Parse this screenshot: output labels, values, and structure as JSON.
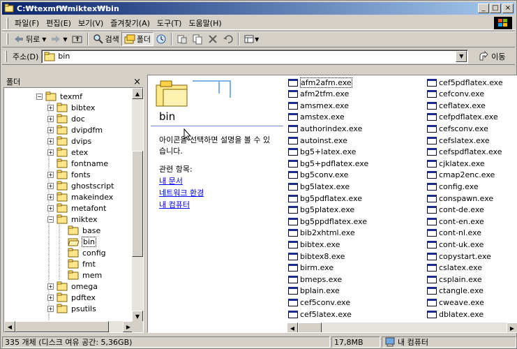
{
  "window": {
    "title": "C:₩texmf₩miktex₩bin",
    "minimize": "_",
    "maximize": "□",
    "close": "×"
  },
  "menu": [
    {
      "label": "파일(F)",
      "name": "menu-file"
    },
    {
      "label": "편집(E)",
      "name": "menu-edit"
    },
    {
      "label": "보기(V)",
      "name": "menu-view"
    },
    {
      "label": "즐겨찾기(A)",
      "name": "menu-favorites"
    },
    {
      "label": "도구(T)",
      "name": "menu-tools"
    },
    {
      "label": "도움말(H)",
      "name": "menu-help"
    }
  ],
  "toolbar": {
    "back_label": "뒤로",
    "search_label": "검색",
    "folders_label": "폴더"
  },
  "address": {
    "label": "주소(D)",
    "value": "bin",
    "go_label": "이동"
  },
  "folder_pane": {
    "header": "폴더",
    "close": "×",
    "tree": [
      {
        "label": "texmf",
        "level": 0,
        "toggle": "−"
      },
      {
        "label": "bibtex",
        "level": 1,
        "toggle": "+"
      },
      {
        "label": "doc",
        "level": 1,
        "toggle": "+"
      },
      {
        "label": "dvipdfm",
        "level": 1,
        "toggle": "+"
      },
      {
        "label": "dvips",
        "level": 1,
        "toggle": "+"
      },
      {
        "label": "etex",
        "level": 1,
        "toggle": "+"
      },
      {
        "label": "fontname",
        "level": 1,
        "toggle": ""
      },
      {
        "label": "fonts",
        "level": 1,
        "toggle": "+"
      },
      {
        "label": "ghostscript",
        "level": 1,
        "toggle": "+"
      },
      {
        "label": "makeindex",
        "level": 1,
        "toggle": "+"
      },
      {
        "label": "metafont",
        "level": 1,
        "toggle": "+"
      },
      {
        "label": "miktex",
        "level": 1,
        "toggle": "−"
      },
      {
        "label": "base",
        "level": 2,
        "toggle": ""
      },
      {
        "label": "bin",
        "level": 2,
        "toggle": "",
        "selected": true
      },
      {
        "label": "config",
        "level": 2,
        "toggle": ""
      },
      {
        "label": "fmt",
        "level": 2,
        "toggle": ""
      },
      {
        "label": "mem",
        "level": 2,
        "toggle": ""
      },
      {
        "label": "omega",
        "level": 1,
        "toggle": "+"
      },
      {
        "label": "pdftex",
        "level": 1,
        "toggle": "+"
      },
      {
        "label": "psutils",
        "level": 1,
        "toggle": "+"
      }
    ]
  },
  "info": {
    "title": "bin",
    "desc_line1": "아이콘을 선택하면 설명을 볼 수 있",
    "desc_line2": "습니다.",
    "related": "관련 항목:",
    "links": [
      "내 문서",
      "네트워크 환경",
      "내 컴퓨터"
    ]
  },
  "files": {
    "column1": [
      "afm2afm.exe",
      "afm2tfm.exe",
      "amsmex.exe",
      "amstex.exe",
      "authorindex.exe",
      "autoinst.exe",
      "bg5+latex.exe",
      "bg5+pdflatex.exe",
      "bg5conv.exe",
      "bg5latex.exe",
      "bg5pdflatex.exe",
      "bg5platex.exe",
      "bg5ppdflatex.exe",
      "bib2xhtml.exe",
      "bibtex.exe",
      "bibtex8.exe",
      "birm.exe",
      "bmeps.exe",
      "bplain.exe",
      "cef5conv.exe",
      "cef5latex.exe"
    ],
    "column2": [
      "cef5pdflatex.exe",
      "cefconv.exe",
      "ceflatex.exe",
      "cefpdflatex.exe",
      "cefsconv.exe",
      "cefslatex.exe",
      "cefspdflatex.exe",
      "cjklatex.exe",
      "cmap2enc.exe",
      "config.exe",
      "conspawn.exe",
      "cont-de.exe",
      "cont-en.exe",
      "cont-nl.exe",
      "cont-uk.exe",
      "copystart.exe",
      "cslatex.exe",
      "csplain.exe",
      "ctangle.exe",
      "cweave.exe",
      "dblatex.exe"
    ]
  },
  "status": {
    "objects": "335 개체 (디스크 여유 공간: 5,36GB)",
    "size": "17,8MB",
    "location": "내 컴퓨터"
  },
  "colors": {
    "title_start": "#0a246a",
    "title_end": "#a6caf0",
    "folder_yellow": "#ffe88c",
    "link": "#0000ff"
  }
}
